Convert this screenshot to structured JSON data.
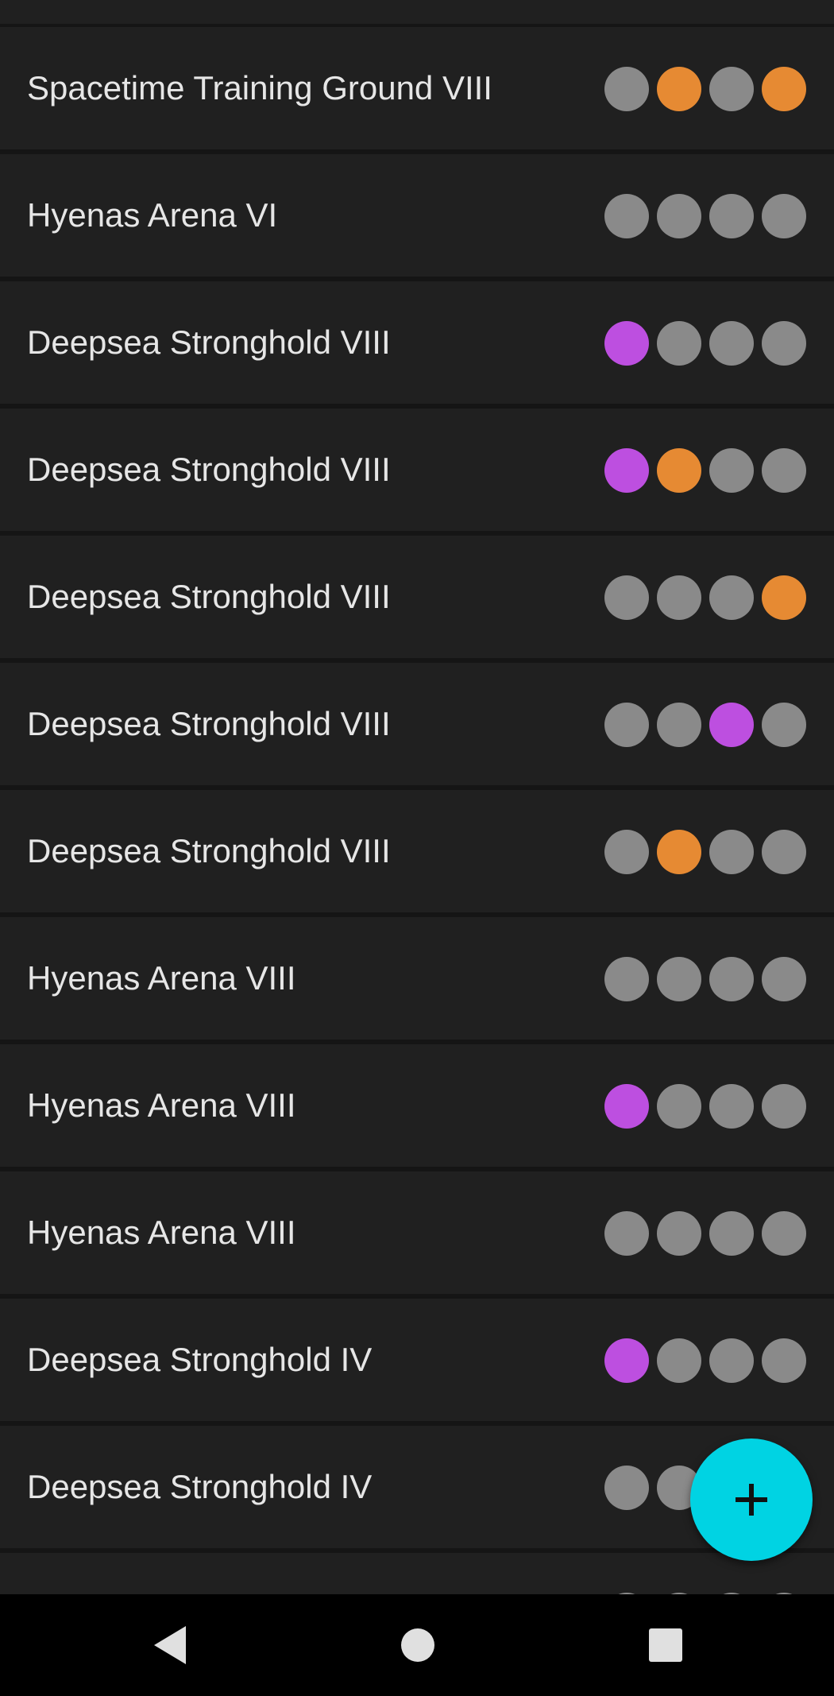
{
  "colors": {
    "row_bg": "#202020",
    "divider": "#151515",
    "text": "#e6e6e6",
    "dot_gray": "#8a8a8a",
    "dot_orange": "#e68a33",
    "dot_purple": "#bd4fe0",
    "fab_bg": "#00d3e3",
    "navbar_bg": "#000000",
    "nav_icon": "#e0e0e0"
  },
  "list": {
    "items": [
      {
        "label": "Spacetime Training Ground VIII",
        "dots": [
          "gray",
          "orange",
          "gray",
          "orange"
        ]
      },
      {
        "label": "Hyenas Arena VI",
        "dots": [
          "gray",
          "gray",
          "gray",
          "gray"
        ]
      },
      {
        "label": "Deepsea Stronghold VIII",
        "dots": [
          "purple",
          "gray",
          "gray",
          "gray"
        ]
      },
      {
        "label": "Deepsea Stronghold VIII",
        "dots": [
          "purple",
          "orange",
          "gray",
          "gray"
        ]
      },
      {
        "label": "Deepsea Stronghold VIII",
        "dots": [
          "gray",
          "gray",
          "gray",
          "orange"
        ]
      },
      {
        "label": "Deepsea Stronghold VIII",
        "dots": [
          "gray",
          "gray",
          "purple",
          "gray"
        ]
      },
      {
        "label": "Deepsea Stronghold VIII",
        "dots": [
          "gray",
          "orange",
          "gray",
          "gray"
        ]
      },
      {
        "label": "Hyenas Arena VIII",
        "dots": [
          "gray",
          "gray",
          "gray",
          "gray"
        ]
      },
      {
        "label": "Hyenas Arena VIII",
        "dots": [
          "purple",
          "gray",
          "gray",
          "gray"
        ]
      },
      {
        "label": "Hyenas Arena VIII",
        "dots": [
          "gray",
          "gray",
          "gray",
          "gray"
        ]
      },
      {
        "label": "Deepsea Stronghold IV",
        "dots": [
          "purple",
          "gray",
          "gray",
          "gray"
        ]
      },
      {
        "label": "Deepsea Stronghold IV",
        "dots": [
          "gray",
          "gray",
          "gray",
          "gray"
        ]
      },
      {
        "label": "",
        "dots": [
          "gray",
          "gray",
          "gray",
          "gray"
        ]
      }
    ]
  },
  "fab": {
    "icon": "plus-icon"
  },
  "navbar": {
    "back_icon": "back-triangle-icon",
    "home_icon": "home-circle-icon",
    "recents_icon": "recents-square-icon"
  }
}
